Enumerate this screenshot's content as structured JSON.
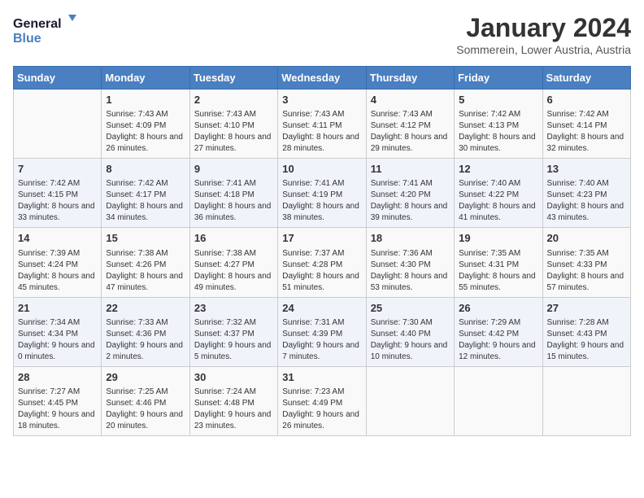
{
  "header": {
    "logo_line1": "General",
    "logo_line2": "Blue",
    "month_year": "January 2024",
    "location": "Sommerein, Lower Austria, Austria"
  },
  "days_of_week": [
    "Sunday",
    "Monday",
    "Tuesday",
    "Wednesday",
    "Thursday",
    "Friday",
    "Saturday"
  ],
  "weeks": [
    [
      {
        "day": "",
        "sunrise": "",
        "sunset": "",
        "daylight": ""
      },
      {
        "day": "1",
        "sunrise": "Sunrise: 7:43 AM",
        "sunset": "Sunset: 4:09 PM",
        "daylight": "Daylight: 8 hours and 26 minutes."
      },
      {
        "day": "2",
        "sunrise": "Sunrise: 7:43 AM",
        "sunset": "Sunset: 4:10 PM",
        "daylight": "Daylight: 8 hours and 27 minutes."
      },
      {
        "day": "3",
        "sunrise": "Sunrise: 7:43 AM",
        "sunset": "Sunset: 4:11 PM",
        "daylight": "Daylight: 8 hours and 28 minutes."
      },
      {
        "day": "4",
        "sunrise": "Sunrise: 7:43 AM",
        "sunset": "Sunset: 4:12 PM",
        "daylight": "Daylight: 8 hours and 29 minutes."
      },
      {
        "day": "5",
        "sunrise": "Sunrise: 7:42 AM",
        "sunset": "Sunset: 4:13 PM",
        "daylight": "Daylight: 8 hours and 30 minutes."
      },
      {
        "day": "6",
        "sunrise": "Sunrise: 7:42 AM",
        "sunset": "Sunset: 4:14 PM",
        "daylight": "Daylight: 8 hours and 32 minutes."
      }
    ],
    [
      {
        "day": "7",
        "sunrise": "Sunrise: 7:42 AM",
        "sunset": "Sunset: 4:15 PM",
        "daylight": "Daylight: 8 hours and 33 minutes."
      },
      {
        "day": "8",
        "sunrise": "Sunrise: 7:42 AM",
        "sunset": "Sunset: 4:17 PM",
        "daylight": "Daylight: 8 hours and 34 minutes."
      },
      {
        "day": "9",
        "sunrise": "Sunrise: 7:41 AM",
        "sunset": "Sunset: 4:18 PM",
        "daylight": "Daylight: 8 hours and 36 minutes."
      },
      {
        "day": "10",
        "sunrise": "Sunrise: 7:41 AM",
        "sunset": "Sunset: 4:19 PM",
        "daylight": "Daylight: 8 hours and 38 minutes."
      },
      {
        "day": "11",
        "sunrise": "Sunrise: 7:41 AM",
        "sunset": "Sunset: 4:20 PM",
        "daylight": "Daylight: 8 hours and 39 minutes."
      },
      {
        "day": "12",
        "sunrise": "Sunrise: 7:40 AM",
        "sunset": "Sunset: 4:22 PM",
        "daylight": "Daylight: 8 hours and 41 minutes."
      },
      {
        "day": "13",
        "sunrise": "Sunrise: 7:40 AM",
        "sunset": "Sunset: 4:23 PM",
        "daylight": "Daylight: 8 hours and 43 minutes."
      }
    ],
    [
      {
        "day": "14",
        "sunrise": "Sunrise: 7:39 AM",
        "sunset": "Sunset: 4:24 PM",
        "daylight": "Daylight: 8 hours and 45 minutes."
      },
      {
        "day": "15",
        "sunrise": "Sunrise: 7:38 AM",
        "sunset": "Sunset: 4:26 PM",
        "daylight": "Daylight: 8 hours and 47 minutes."
      },
      {
        "day": "16",
        "sunrise": "Sunrise: 7:38 AM",
        "sunset": "Sunset: 4:27 PM",
        "daylight": "Daylight: 8 hours and 49 minutes."
      },
      {
        "day": "17",
        "sunrise": "Sunrise: 7:37 AM",
        "sunset": "Sunset: 4:28 PM",
        "daylight": "Daylight: 8 hours and 51 minutes."
      },
      {
        "day": "18",
        "sunrise": "Sunrise: 7:36 AM",
        "sunset": "Sunset: 4:30 PM",
        "daylight": "Daylight: 8 hours and 53 minutes."
      },
      {
        "day": "19",
        "sunrise": "Sunrise: 7:35 AM",
        "sunset": "Sunset: 4:31 PM",
        "daylight": "Daylight: 8 hours and 55 minutes."
      },
      {
        "day": "20",
        "sunrise": "Sunrise: 7:35 AM",
        "sunset": "Sunset: 4:33 PM",
        "daylight": "Daylight: 8 hours and 57 minutes."
      }
    ],
    [
      {
        "day": "21",
        "sunrise": "Sunrise: 7:34 AM",
        "sunset": "Sunset: 4:34 PM",
        "daylight": "Daylight: 9 hours and 0 minutes."
      },
      {
        "day": "22",
        "sunrise": "Sunrise: 7:33 AM",
        "sunset": "Sunset: 4:36 PM",
        "daylight": "Daylight: 9 hours and 2 minutes."
      },
      {
        "day": "23",
        "sunrise": "Sunrise: 7:32 AM",
        "sunset": "Sunset: 4:37 PM",
        "daylight": "Daylight: 9 hours and 5 minutes."
      },
      {
        "day": "24",
        "sunrise": "Sunrise: 7:31 AM",
        "sunset": "Sunset: 4:39 PM",
        "daylight": "Daylight: 9 hours and 7 minutes."
      },
      {
        "day": "25",
        "sunrise": "Sunrise: 7:30 AM",
        "sunset": "Sunset: 4:40 PM",
        "daylight": "Daylight: 9 hours and 10 minutes."
      },
      {
        "day": "26",
        "sunrise": "Sunrise: 7:29 AM",
        "sunset": "Sunset: 4:42 PM",
        "daylight": "Daylight: 9 hours and 12 minutes."
      },
      {
        "day": "27",
        "sunrise": "Sunrise: 7:28 AM",
        "sunset": "Sunset: 4:43 PM",
        "daylight": "Daylight: 9 hours and 15 minutes."
      }
    ],
    [
      {
        "day": "28",
        "sunrise": "Sunrise: 7:27 AM",
        "sunset": "Sunset: 4:45 PM",
        "daylight": "Daylight: 9 hours and 18 minutes."
      },
      {
        "day": "29",
        "sunrise": "Sunrise: 7:25 AM",
        "sunset": "Sunset: 4:46 PM",
        "daylight": "Daylight: 9 hours and 20 minutes."
      },
      {
        "day": "30",
        "sunrise": "Sunrise: 7:24 AM",
        "sunset": "Sunset: 4:48 PM",
        "daylight": "Daylight: 9 hours and 23 minutes."
      },
      {
        "day": "31",
        "sunrise": "Sunrise: 7:23 AM",
        "sunset": "Sunset: 4:49 PM",
        "daylight": "Daylight: 9 hours and 26 minutes."
      },
      {
        "day": "",
        "sunrise": "",
        "sunset": "",
        "daylight": ""
      },
      {
        "day": "",
        "sunrise": "",
        "sunset": "",
        "daylight": ""
      },
      {
        "day": "",
        "sunrise": "",
        "sunset": "",
        "daylight": ""
      }
    ]
  ]
}
